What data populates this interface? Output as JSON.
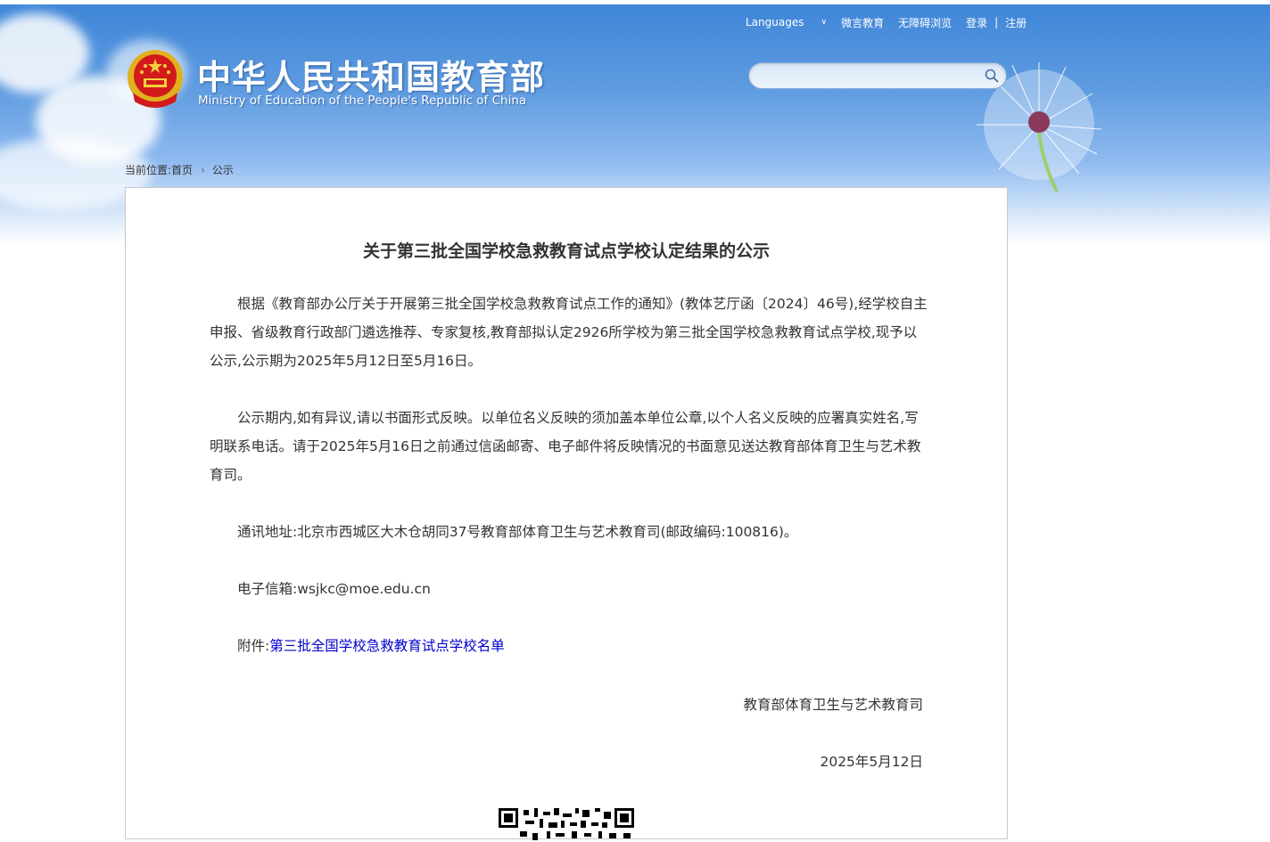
{
  "header": {
    "links": [
      "Languages",
      "微言教育",
      "无障碍浏览",
      "登录",
      "注册"
    ],
    "title_cn": "中华人民共和国教育部",
    "title_en": "Ministry of Education of the People's Republic of China",
    "search": {
      "placeholder": "",
      "value": ""
    }
  },
  "breadcrumb": {
    "prefix": "当前位置:",
    "items": [
      "首页",
      "公示"
    ]
  },
  "article": {
    "title": "关于第三批全国学校急救教育试点学校认定结果的公示",
    "paragraphs": [
      "根据《教育部办公厅关于开展第三批全国学校急救教育试点工作的通知》(教体艺厅函〔2024〕46号),经学校自主申报、省级教育行政部门遴选推荐、专家复核,教育部拟认定2926所学校为第三批全国学校急救教育试点学校,现予以公示,公示期为2025年5月12日至5月16日。",
      "公示期内,如有异议,请以书面形式反映。以单位名义反映的须加盖本单位公章,以个人名义反映的应署真实姓名,写明联系电话。请于2025年5月16日之前通过信函邮寄、电子邮件将反映情况的书面意见送达教育部体育卫生与艺术教育司。",
      "通讯地址:北京市西城区大木仓胡同37号教育部体育卫生与艺术教育司(邮政编码:100816)。",
      "电子信箱:wsjkc@moe.edu.cn"
    ],
    "attachment_label": "附件:",
    "attachment_link": "第三批全国学校急救教育试点学校名单",
    "signature": "教育部体育卫生与艺术教育司",
    "date": "2025年5月12日"
  },
  "colors": {
    "link": "#0000cc",
    "text": "#333333",
    "sky": "#3f86d8"
  },
  "icons": [
    "national-emblem-icon",
    "search-icon",
    "chevron-down-icon",
    "qr-code"
  ]
}
